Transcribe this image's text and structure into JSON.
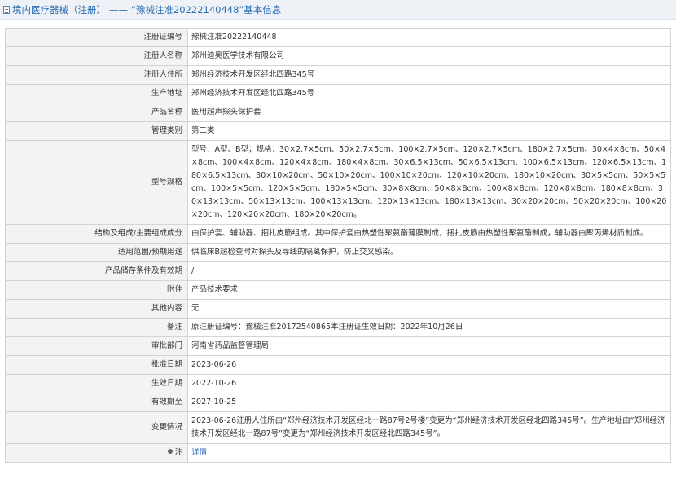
{
  "header": {
    "prefix": "境内医疗器械（注册）",
    "separator": "——",
    "title": "“豫械注准20222140448”基本信息"
  },
  "rows": [
    {
      "label": "注册证编号",
      "value": "豫械注准20222140448"
    },
    {
      "label": "注册人名称",
      "value": "郑州迪奥医学技术有限公司"
    },
    {
      "label": "注册人住所",
      "value": "郑州经济技术开发区经北四路345号"
    },
    {
      "label": "生产地址",
      "value": "郑州经济技术开发区经北四路345号"
    },
    {
      "label": "产品名称",
      "value": "医用超声探头保护套"
    },
    {
      "label": "管理类别",
      "value": "第二类"
    },
    {
      "label": "型号规格",
      "value": "型号：A型、B型；规格：30×2.7×5cm、50×2.7×5cm、100×2.7×5cm、120×2.7×5cm、180×2.7×5cm、30×4×8cm、50×4×8cm、100×4×8cm、120×4×8cm、180×4×8cm、30×6.5×13cm、50×6.5×13cm、100×6.5×13cm、120×6.5×13cm、180×6.5×13cm、30×10×20cm、50×10×20cm、100×10×20cm、120×10×20cm、180×10×20cm、30×5×5cm、50×5×5cm、100×5×5cm、120×5×5cm、180×5×5cm、30×8×8cm、50×8×8cm、100×8×8cm、120×8×8cm、180×8×8cm、30×13×13cm、50×13×13cm、100×13×13cm、120×13×13cm、180×13×13cm、30×20×20cm、50×20×20cm、100×20×20cm、120×20×20cm、180×20×20cm。"
    },
    {
      "label": "结构及组成/主要组成成分",
      "value": "由保护套、辅助器、捆扎皮筋组成。其中保护套由热塑性聚氨酯薄膜制成，捆扎皮筋由热塑性聚氨酯制成，辅助器由聚丙烯材质制成。"
    },
    {
      "label": "适用范围/预期用途",
      "value": "供临床B超检查时对探头及导线的隔离保护，防止交叉感染。"
    },
    {
      "label": "产品储存条件及有效期",
      "value": "/"
    },
    {
      "label": "附件",
      "value": "产品技术要求"
    },
    {
      "label": "其他内容",
      "value": "无"
    },
    {
      "label": "备注",
      "value": "原注册证编号：豫械注准20172540865本注册证生效日期：2022年10月26日"
    },
    {
      "label": "审批部门",
      "value": "河南省药品监督管理局"
    },
    {
      "label": "批准日期",
      "value": "2023-06-26"
    },
    {
      "label": "生效日期",
      "value": "2022-10-26"
    },
    {
      "label": "有效期至",
      "value": "2027-10-25"
    },
    {
      "label": "变更情况",
      "value": "2023-06-26注册人住所由“郑州经济技术开发区经北一路87号2号楼”变更为“郑州经济技术开发区经北四路345号”。生产地址由“郑州经济技术开发区经北一路87号”变更为“郑州经济技术开发区经北四路345号”。"
    }
  ],
  "notice": {
    "icon": "bulb-icon",
    "label": "注",
    "link_text": "详情"
  }
}
